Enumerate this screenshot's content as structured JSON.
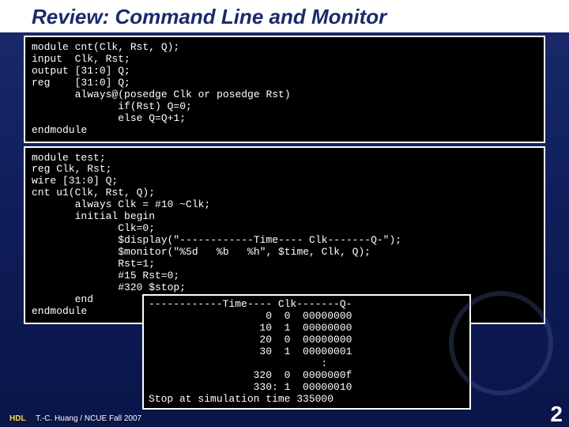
{
  "title": "Review: Command Line and Monitor",
  "code1": "module cnt(Clk, Rst, Q);\ninput  Clk, Rst;\noutput [31:0] Q;\nreg    [31:0] Q;\n       always@(posedge Clk or posedge Rst)\n              if(Rst) Q=0;\n              else Q=Q+1;\nendmodule",
  "code2": "module test;\nreg Clk, Rst;\nwire [31:0] Q;\ncnt u1(Clk, Rst, Q);\n       always Clk = #10 ~Clk;\n       initial begin\n              Clk=0;\n              $display(\"------------Time---- Clk-------Q-\");\n              $monitor(\"%5d   %b   %h\", $time, Clk, Q);\n              Rst=1;\n              #15 Rst=0;\n              #320 $stop;\n       end\nendmodule",
  "output": "------------Time---- Clk-------Q-\n                   0  0  00000000\n                  10  1  00000000\n                  20  0  00000000\n                  30  1  00000001\n                            :\n                 320  0  0000000f\n                 330: 1  00000010\nStop at simulation time 335000",
  "footer_hdl": "HDL",
  "footer_text": "T.-C. Huang / NCUE  Fall 2007",
  "slide_num": "2"
}
